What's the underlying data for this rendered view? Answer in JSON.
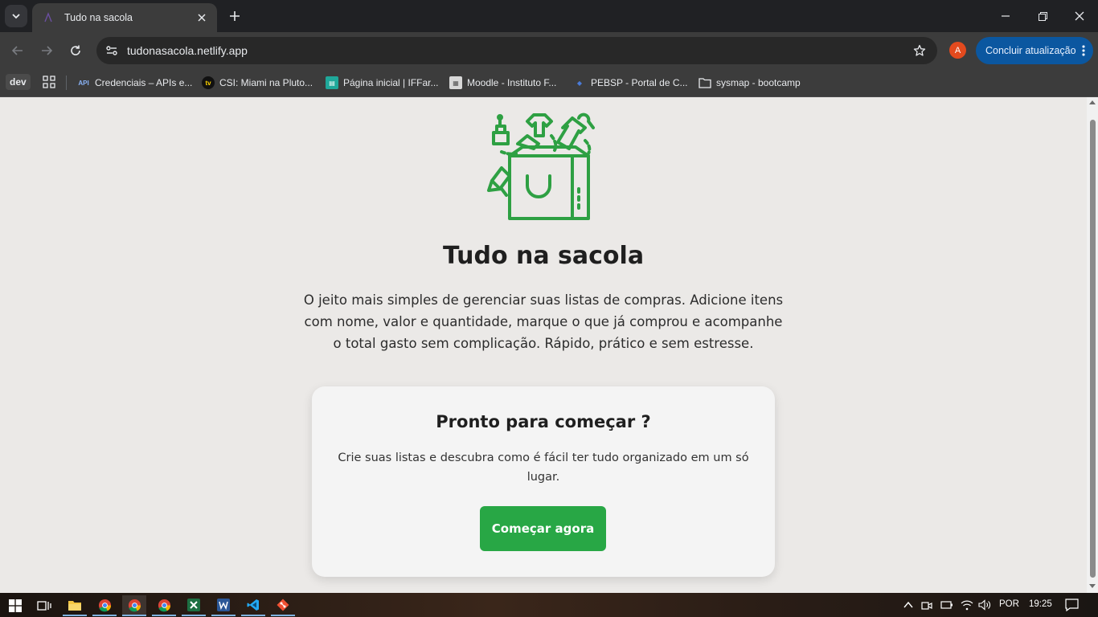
{
  "browser": {
    "tab": {
      "title": "Tudo na sacola"
    },
    "omnibox": {
      "url": "tudonasacola.netlify.app"
    },
    "profile_initial": "A",
    "update_label": "Concluir atualização",
    "bookmarks": {
      "dev": "dev",
      "items": [
        {
          "label": "Credenciais – APIs e...",
          "icon": "api-icon"
        },
        {
          "label": "CSI: Miami na Pluto...",
          "icon": "tv-icon"
        },
        {
          "label": "Página inicial | IFFar...",
          "icon": "iffar-icon"
        },
        {
          "label": "Moodle - Instituto F...",
          "icon": "moodle-icon"
        },
        {
          "label": "PEBSP - Portal de C...",
          "icon": "pebsp-icon"
        },
        {
          "label": "sysmap - bootcamp",
          "icon": "folder-icon"
        }
      ]
    }
  },
  "page": {
    "title": "Tudo na sacola",
    "description": "O jeito mais simples de gerenciar suas listas de compras. Adicione itens com nome, valor e quantidade, marque o que já comprou e acompanhe o total gasto sem complicação. Rápido, prático e sem estresse.",
    "card": {
      "title": "Pronto para começar ?",
      "text": "Crie suas listas e descubra como é fácil ter tudo organizado em um só lugar.",
      "cta_label": "Começar agora"
    },
    "accent_color": "#28a745"
  },
  "taskbar": {
    "language": "POR",
    "time": "19:25"
  }
}
